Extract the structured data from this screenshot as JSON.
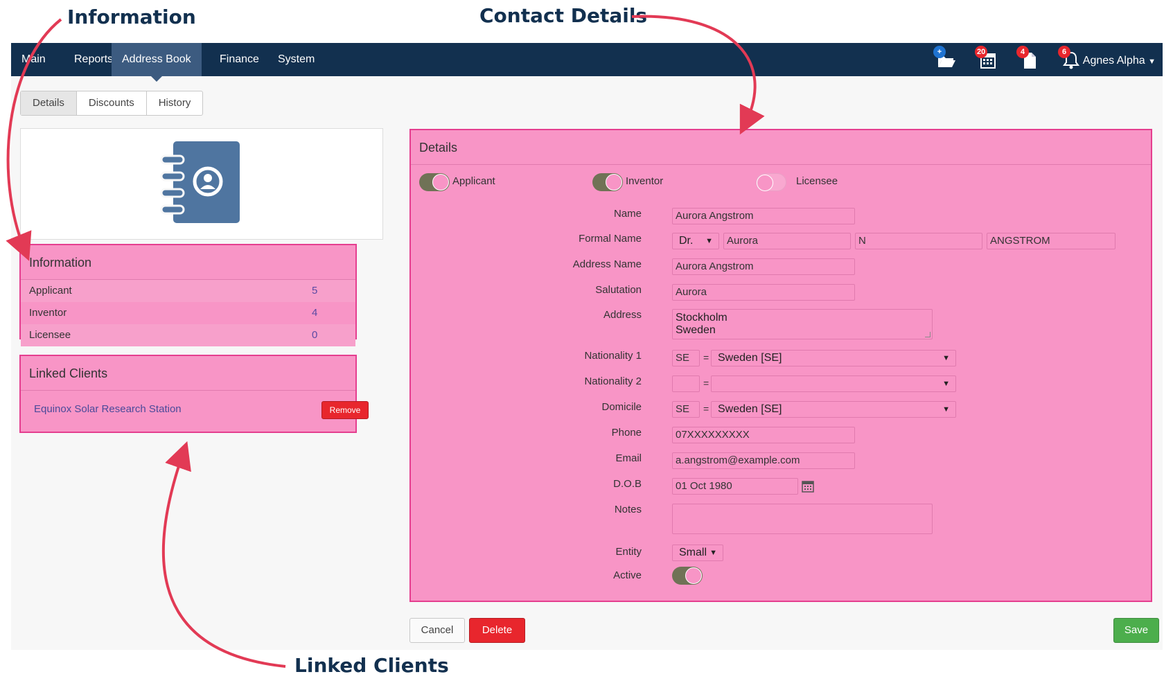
{
  "callouts": {
    "information": "Information",
    "contact_details": "Contact Details",
    "linked_clients": "Linked Clients"
  },
  "navbar": {
    "items": [
      "Main",
      "Reports",
      "Address Book",
      "Finance",
      "System"
    ],
    "active": "Address Book",
    "badges": {
      "folder": "+",
      "calendar": "20",
      "document": "4",
      "bell": "6"
    },
    "user": "Agnes Alpha"
  },
  "tabs": [
    "Details",
    "Discounts",
    "History"
  ],
  "information": {
    "title": "Information",
    "rows": [
      {
        "label": "Applicant",
        "count": "5"
      },
      {
        "label": "Inventor",
        "count": "4"
      },
      {
        "label": "Licensee",
        "count": "0"
      }
    ]
  },
  "linked_clients": {
    "title": "Linked Clients",
    "client": "Equinox Solar Research Station",
    "remove_label": "Remove"
  },
  "details": {
    "title": "Details",
    "roles": {
      "applicant": "Applicant",
      "inventor": "Inventor",
      "licensee": "Licensee"
    },
    "role_state": {
      "applicant": true,
      "inventor": true,
      "licensee": false
    },
    "labels": {
      "name": "Name",
      "formal_name": "Formal Name",
      "address_name": "Address Name",
      "salutation": "Salutation",
      "address": "Address",
      "nationality1": "Nationality 1",
      "nationality2": "Nationality 2",
      "domicile": "Domicile",
      "phone": "Phone",
      "email": "Email",
      "dob": "D.O.B",
      "notes": "Notes",
      "entity": "Entity",
      "active": "Active"
    },
    "values": {
      "name": "Aurora Angstrom",
      "title": "Dr.",
      "first_name": "Aurora",
      "middle": "N",
      "last_name": "ANGSTROM",
      "address_name": "Aurora Angstrom",
      "salutation": "Aurora",
      "address_line1": "Stockholm",
      "address_line2": "Sweden",
      "nationality1_code": "SE",
      "nationality1_country": "Sweden [SE]",
      "nationality2_code": "",
      "nationality2_country": "",
      "domicile_code": "SE",
      "domicile_country": "Sweden [SE]",
      "phone": "07XXXXXXXXX",
      "email": "a.angstrom@example.com",
      "dob": "01 Oct 1980",
      "notes": "",
      "entity": "Small",
      "active": true
    }
  },
  "buttons": {
    "cancel": "Cancel",
    "delete": "Delete",
    "save": "Save"
  }
}
